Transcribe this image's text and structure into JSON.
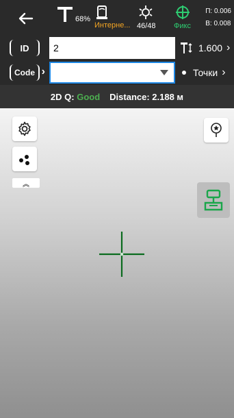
{
  "status": {
    "battery_percent": "68%",
    "network_label": "Интерне...",
    "satellites": "46/48",
    "fix_label": "Фикс",
    "precision_h": "П: 0.006",
    "precision_v": "В: 0.008"
  },
  "row_id": {
    "tag": "ID",
    "value": "2",
    "antenna_height": "1.600"
  },
  "row_code": {
    "tag": "Code",
    "value": "",
    "points_label": "Точки"
  },
  "quality": {
    "label_2d": "2D Q:",
    "value": "Good",
    "distance_label": "Distance: 2.188 м"
  },
  "colors": {
    "good": "#4caf50",
    "fix": "#2ecc71",
    "network": "#f5a623",
    "focus_border": "#1e88e5"
  }
}
